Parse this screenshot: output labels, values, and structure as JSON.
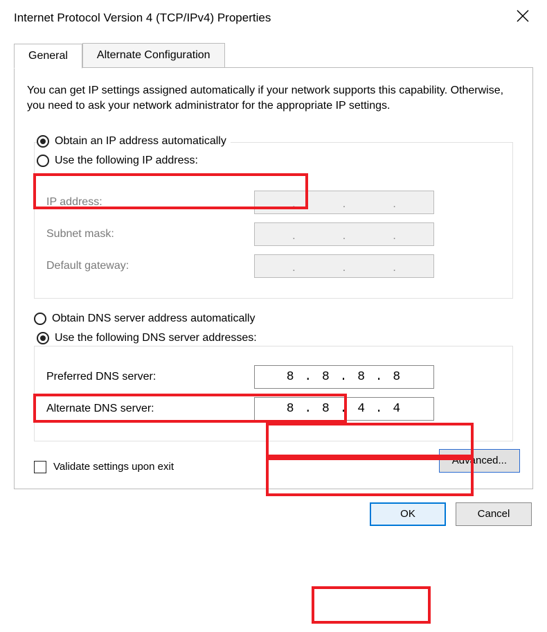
{
  "window": {
    "title": "Internet Protocol Version 4 (TCP/IPv4) Properties"
  },
  "tabs": {
    "general": "General",
    "alternate": "Alternate Configuration"
  },
  "description": "You can get IP settings assigned automatically if your network supports this capability. Otherwise, you need to ask your network administrator for the appropriate IP settings.",
  "ip_section": {
    "auto_label": "Obtain an IP address automatically",
    "manual_label": "Use the following IP address:",
    "ip_label": "IP address:",
    "subnet_label": "Subnet mask:",
    "gateway_label": "Default gateway:",
    "ip_value": "",
    "subnet_value": "",
    "gateway_value": "",
    "mode": "auto"
  },
  "dns_section": {
    "auto_label": "Obtain DNS server address automatically",
    "manual_label": "Use the following DNS server addresses:",
    "preferred_label": "Preferred DNS server:",
    "alternate_label": "Alternate DNS server:",
    "preferred_value": "8 . 8 . 8 . 8",
    "alternate_value": "8 . 8 . 4 . 4",
    "mode": "manual"
  },
  "validate_label": "Validate settings upon exit",
  "validate_checked": false,
  "buttons": {
    "advanced": "Advanced...",
    "ok": "OK",
    "cancel": "Cancel"
  }
}
